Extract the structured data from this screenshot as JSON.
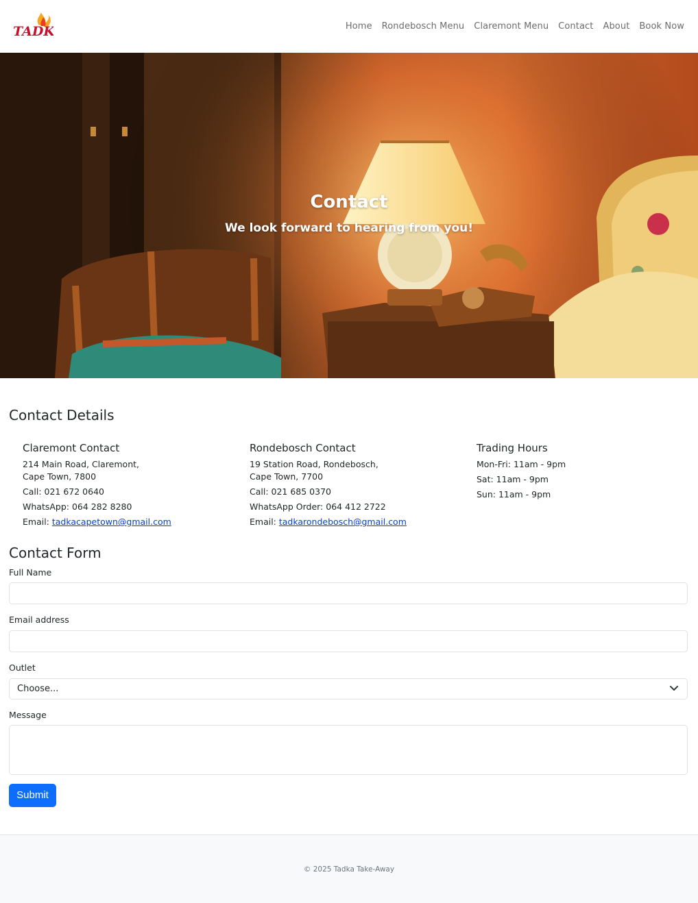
{
  "brand": {
    "logo_text": "TADKA"
  },
  "nav": {
    "items": [
      "Home",
      "Rondebosch Menu",
      "Claremont Menu",
      "Contact",
      "About",
      "Book Now"
    ]
  },
  "hero": {
    "title": "Contact",
    "subtitle": "We look forward to hearing from you!"
  },
  "details": {
    "heading": "Contact Details",
    "claremont": {
      "title": "Claremont Contact",
      "address1": "214 Main Road, Claremont,",
      "address2": "Cape Town, 7800",
      "call": "Call: 021 672 0640",
      "whatsapp": "WhatsApp: 064 282 8280",
      "email_label": "Email: ",
      "email": "tadkacapetown@gmail.com"
    },
    "rondebosch": {
      "title": "Rondebosch Contact",
      "address1": "19 Station Road, Rondebosch,",
      "address2": "Cape Town, 7700",
      "call": "Call: 021 685 0370",
      "whatsapp": "WhatsApp Order: 064 412 2722",
      "email_label": "Email: ",
      "email": "tadkarondebosch@gmail.com"
    },
    "hours": {
      "title": "Trading Hours",
      "lines": [
        "Mon-Fri: 11am - 9pm",
        "Sat: 11am - 9pm",
        "Sun: 11am - 9pm"
      ]
    }
  },
  "form": {
    "heading": "Contact Form",
    "full_name_label": "Full Name",
    "full_name_value": "",
    "email_label": "Email address",
    "email_value": "",
    "outlet_label": "Outlet",
    "outlet_selected": "Choose...",
    "message_label": "Message",
    "message_value": "",
    "submit_label": "Submit"
  },
  "footer": {
    "text": "© 2025 Tadka Take-Away"
  },
  "colors": {
    "primary_button": "#0d6efd",
    "link": "#0d3bd6",
    "footer_bg": "#f8f9fa"
  }
}
